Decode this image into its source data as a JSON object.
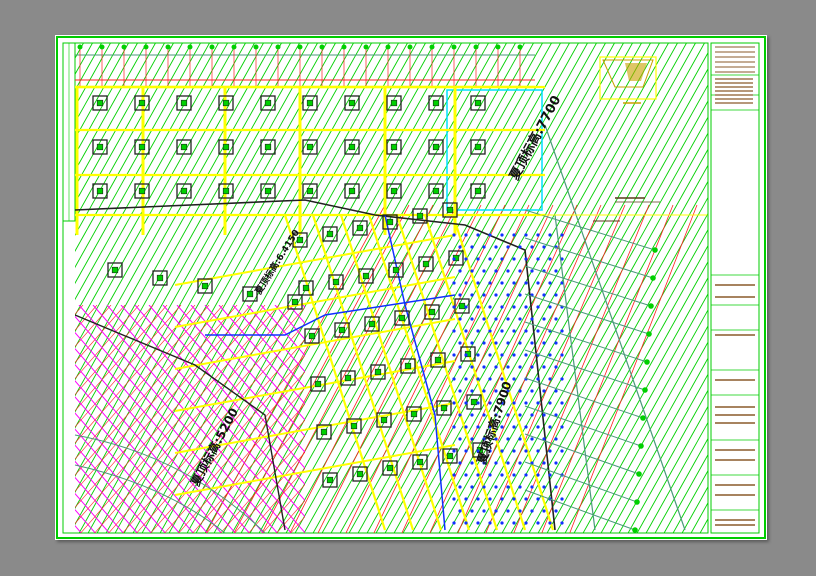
{
  "viewer": {
    "background_color": "#8a8a8a",
    "sheet_color": "#ffffff"
  },
  "drawing": {
    "zone_labels": [
      {
        "text": "夏顶标高:7700"
      },
      {
        "text": "夏顶标高:7900"
      },
      {
        "text": "夏顶标高:5200"
      },
      {
        "text": "夏顶标高:6.4150"
      }
    ],
    "palette": {
      "frame": "#00cc00",
      "hatch": "#00d000",
      "yellow": "#ffff00",
      "cyan": "#00e0ff",
      "magenta": "#ff00ff",
      "red": "#ff2020",
      "blue": "#1030ff",
      "teal": "#4a9a7a",
      "black": "#222222"
    }
  },
  "title_block": {
    "line_color": "#00cc00",
    "text_color": "#8a5a2a"
  }
}
